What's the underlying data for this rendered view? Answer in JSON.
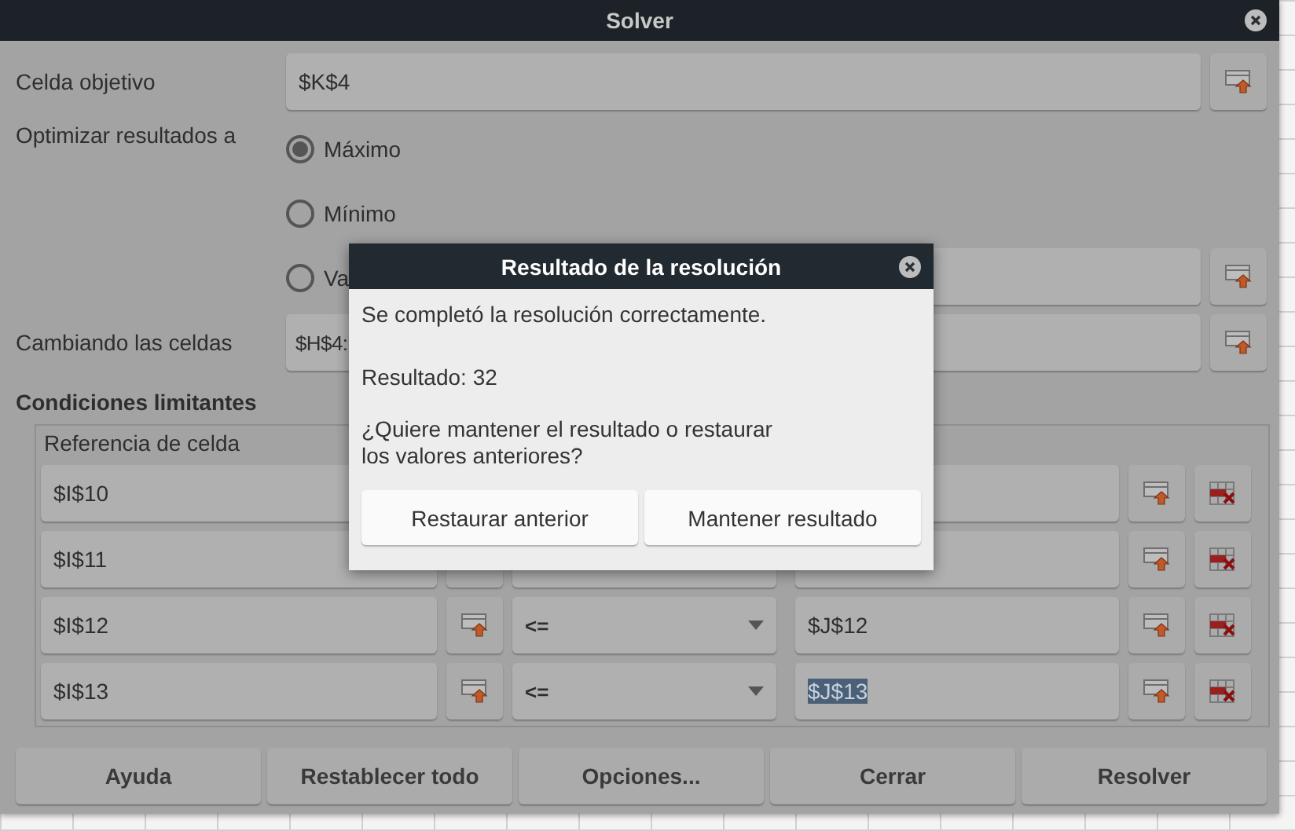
{
  "window": {
    "title": "Solver"
  },
  "target_cell": {
    "label": "Celda objetivo",
    "value": "$K$4"
  },
  "optimize": {
    "label": "Optimizar resultados a",
    "options": [
      {
        "label": "Máximo",
        "selected": true
      },
      {
        "label": "Mínimo",
        "selected": false
      },
      {
        "label": "Va",
        "selected": false
      }
    ]
  },
  "changing_cells": {
    "label": "Cambiando las celdas",
    "value": "$H$4:"
  },
  "constraints": {
    "title": "Condiciones limitantes",
    "column_1": "Referencia de celda",
    "rows": [
      {
        "reference": "$I$10"
      },
      {
        "reference": "$I$11"
      },
      {
        "reference": "$I$12",
        "operator": "<=",
        "value": "$J$12",
        "value_selected": false
      },
      {
        "reference": "$I$13",
        "operator": "<=",
        "value": "$J$13",
        "value_selected": true
      }
    ]
  },
  "buttons": [
    "Ayuda",
    "Restablecer todo",
    "Opciones...",
    "Cerrar",
    "Resolver"
  ],
  "dialog": {
    "title": "Resultado de la resolución",
    "message": "Se completó la resolución correctamente.",
    "result": "Resultado: 32",
    "question": "¿Quiere mantener el resultado o restaurar\nlos valores anteriores?",
    "buttons": [
      "Restaurar anterior",
      "Mantener resultado"
    ]
  }
}
